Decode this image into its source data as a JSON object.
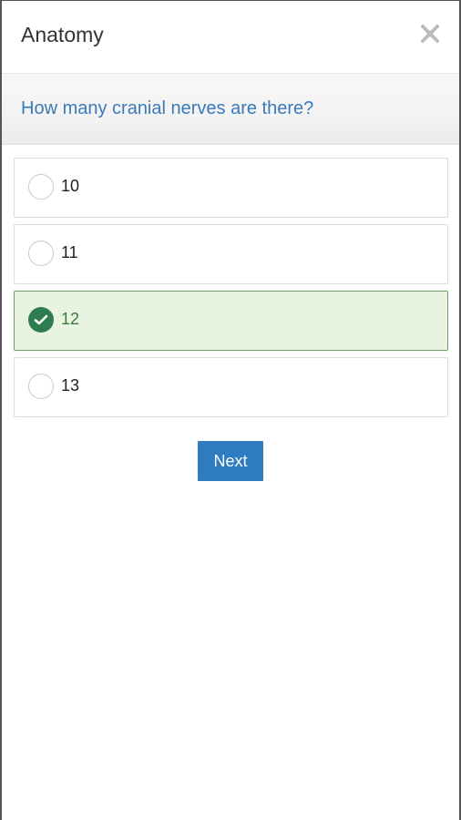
{
  "header": {
    "title": "Anatomy",
    "close_icon": "close-icon"
  },
  "question": {
    "text": "How many cranial nerves are there?"
  },
  "options": [
    {
      "label": "10",
      "selected": false
    },
    {
      "label": "11",
      "selected": false
    },
    {
      "label": "12",
      "selected": true
    },
    {
      "label": "13",
      "selected": false
    }
  ],
  "actions": {
    "next_label": "Next"
  },
  "colors": {
    "accent": "#2f7bbf",
    "question_text": "#3a7ab8",
    "selected_bg": "#e8f4e1",
    "selected_check": "#2e7d4f"
  }
}
